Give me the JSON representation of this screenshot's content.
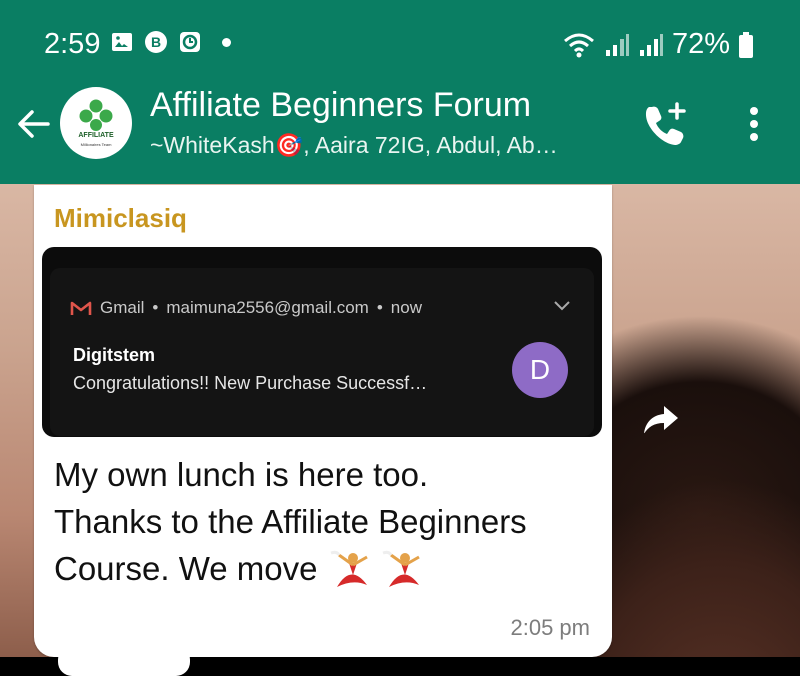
{
  "status_bar": {
    "time": "2:59",
    "battery": "72%",
    "icons": [
      "gallery-icon",
      "b-app-icon",
      "clock-app-icon",
      "dot-icon",
      "wifi-icon",
      "signal-icon",
      "signal-icon",
      "battery-icon"
    ]
  },
  "header": {
    "title": "Affiliate Beginners Forum",
    "subtitle": "~WhiteKash🎯, Aaira 72IG, Abdul, Ab…",
    "avatar_text": "AFFILIATE",
    "avatar_subtext": "Millionaires Team",
    "back_icon": "back-arrow-icon",
    "call_icon": "add-call-icon",
    "menu_icon": "more-vert-icon"
  },
  "message": {
    "sender": "Mimiclasiq",
    "screenshot": {
      "app": "Gmail",
      "account": "maimuna2556@gmail.com",
      "when": "now",
      "title": "Digitstem",
      "body": "Congratulations!! New Purchase Successf…",
      "avatar_letter": "D"
    },
    "text_line1": "My own lunch is here too.",
    "text_line2": "Thanks to the Affiliate Beginners",
    "text_line3": "Course. We move",
    "emoji": [
      "woman-dancing-emoji",
      "woman-dancing-emoji"
    ],
    "time": "2:05 pm"
  },
  "colors": {
    "header_bg": "#0a7e63",
    "sender": "#c89620",
    "notif_avatar": "#8e6bc6"
  }
}
